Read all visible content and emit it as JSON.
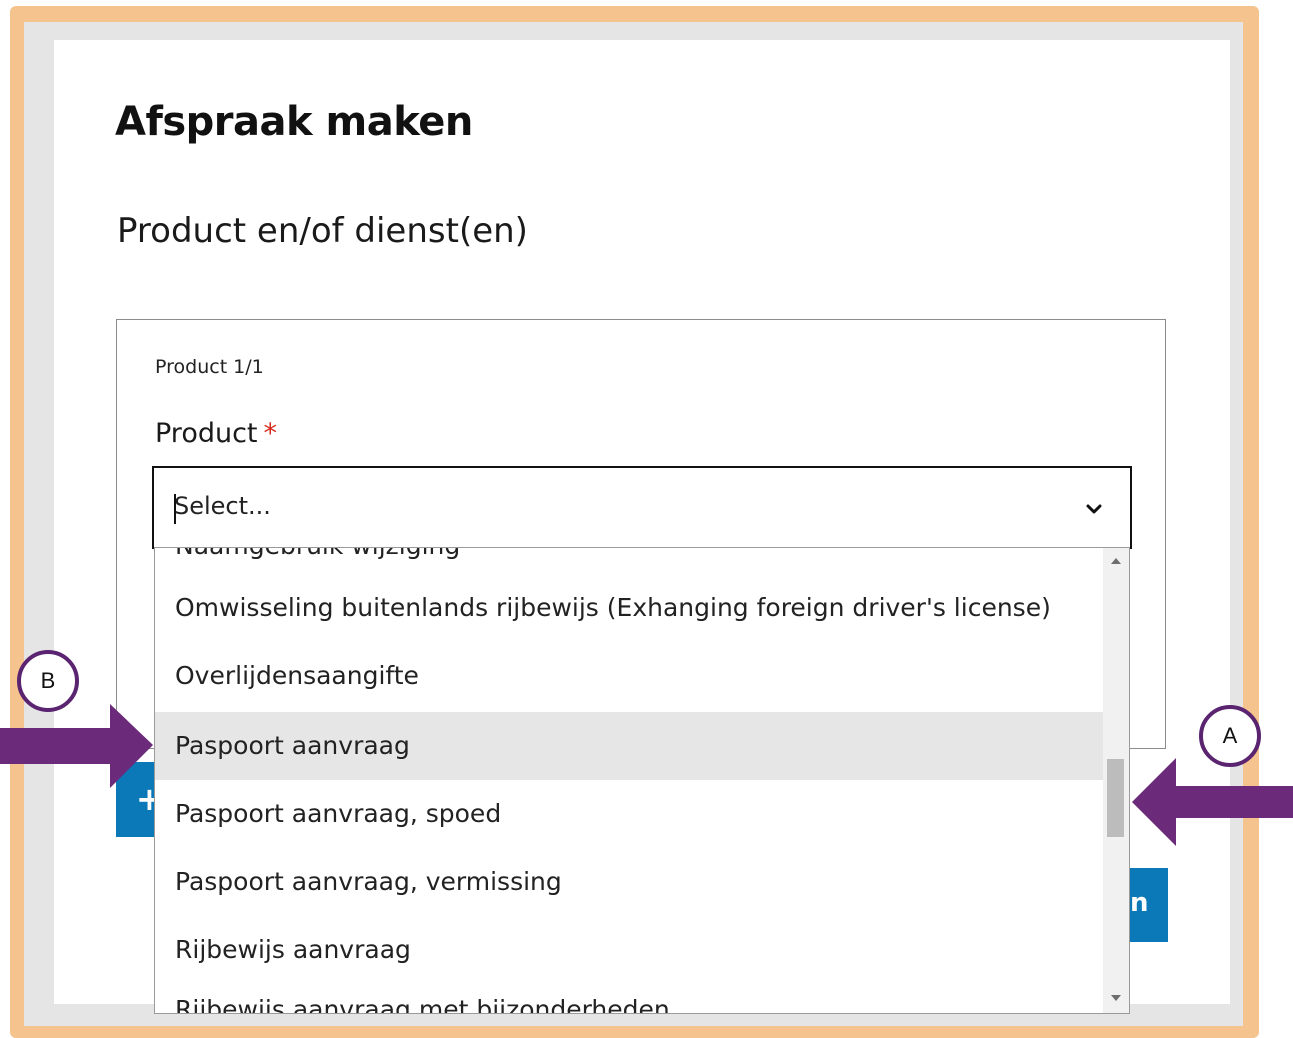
{
  "page": {
    "title": "Afspraak maken",
    "section_title": "Product en/of dienst(en)"
  },
  "product_block": {
    "counter": "Product 1/1",
    "label": "Product",
    "required_mark": "*",
    "select_value": "Select...",
    "dropdown_icon": "chevron-down-icon"
  },
  "dropdown": {
    "partial_top": "Naamgebruik wijziging",
    "options": [
      {
        "label": "Omwisseling buitenlands rijbewijs (Exhanging foreign driver's license)"
      },
      {
        "label": "Overlijdensaangifte"
      },
      {
        "label": "Paspoort aanvraag",
        "highlighted": true
      },
      {
        "label": "Paspoort aanvraag, spoed"
      },
      {
        "label": "Paspoort aanvraag, vermissing"
      },
      {
        "label": "Rijbewijs aanvraag"
      }
    ],
    "partial_bottom": "Rijbewijs aanvraag met bijzonderheden",
    "scroll_position": 0.45
  },
  "buttons": {
    "add_label": "+",
    "next_label": "n"
  },
  "annotations": {
    "callout_a": "A",
    "callout_b": "B",
    "arrow_color": "#6b2a7a"
  },
  "colors": {
    "frame_outer": "#f5c48e",
    "frame_inner": "#e5e5e5",
    "button_blue": "#0b78b8",
    "highlight_row": "#e6e6e6",
    "required": "#d52b1e"
  }
}
